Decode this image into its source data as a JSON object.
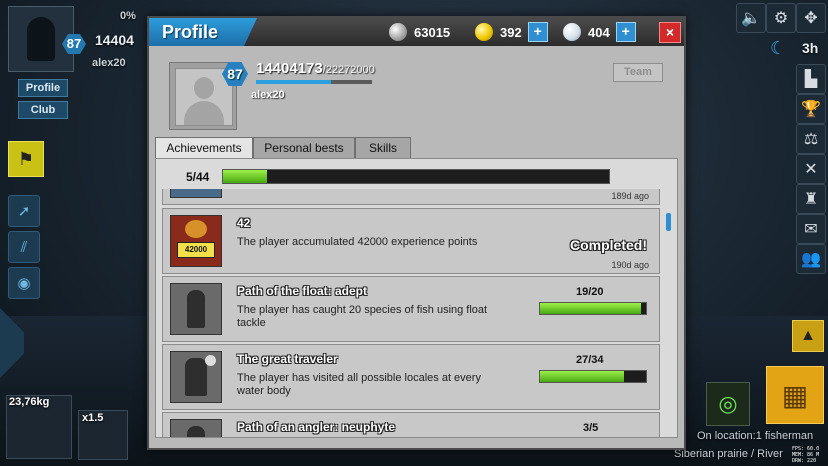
{
  "hud": {
    "player_level": "87",
    "player_xp_short": "14404",
    "player_name": "alex20",
    "profile_btn": "Profile",
    "club_btn": "Club",
    "hunger_pct": "0%",
    "time_left": "3h",
    "weight_left": "23,76kg",
    "multiplier": "x1.5",
    "location_status": "On location:1 fisherman",
    "location_name": "Siberian prairie / River",
    "fps_line1": "FPS: 60.0",
    "fps_line2": "MEM: 86 M",
    "fps_line3": "DRW: 220"
  },
  "dialog": {
    "title": "Profile",
    "currencies": {
      "silver": "63015",
      "gold": "392",
      "pearls": "404"
    },
    "close_label": "×",
    "profile": {
      "level": "87",
      "xp": "14404173",
      "xp_max": "/22272000",
      "xp_progress": 0.647,
      "name": "alex20",
      "team_label": "Team"
    },
    "tabs": [
      "Achievements",
      "Personal bests",
      "Skills"
    ],
    "active_tab": "Achievements",
    "achievements_progress": {
      "label": "5/44",
      "fraction": 0.114
    },
    "achievements": [
      {
        "title": "",
        "date": "189d ago",
        "icon": "achievement-icon"
      },
      {
        "title": "42",
        "description": "The player accumulated 42000 experience points",
        "status": "Completed!",
        "date": "190d ago",
        "icon_label": "42000",
        "icon": "experience-sign-icon"
      },
      {
        "title": "Path of the float: adept",
        "description": "The player has caught 20 species of fish using float tackle",
        "progress_label": "19/20",
        "progress": 0.95,
        "icon": "fisherman-float-icon"
      },
      {
        "title": "The great traveler",
        "description": "The player has visited all possible locales at every water body",
        "progress_label": "27/34",
        "progress": 0.794,
        "icon": "traveler-icon"
      },
      {
        "title": "Path of an angler: neuphyte",
        "progress_label": "3/5",
        "icon": "angler-icon"
      }
    ]
  }
}
